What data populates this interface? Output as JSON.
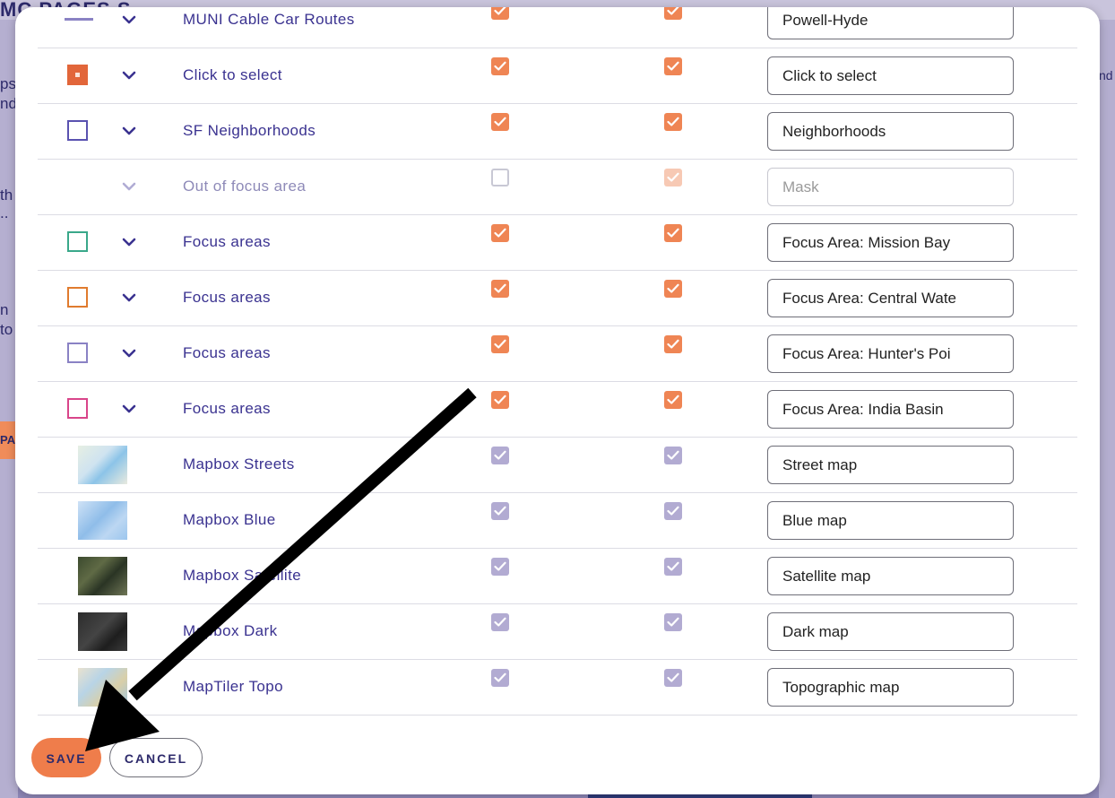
{
  "background": {
    "title_fragment": "MC PAGES S",
    "left_fragments": [
      "ps",
      "nd",
      "th",
      "..",
      "n",
      "to"
    ],
    "left_button_fragment": "PA",
    "right_fragment": "nd"
  },
  "layers": [
    {
      "swatch": "line",
      "chevron": true,
      "name": "MUNI Cable Car Routes",
      "c1": "on",
      "c2": "on",
      "label": "Powell-Hyde",
      "dim": false
    },
    {
      "swatch": "fill",
      "chevron": true,
      "name": "Click to select",
      "c1": "on",
      "c2": "on",
      "label": "Click to select",
      "dim": false
    },
    {
      "swatch": "outline",
      "color": "#5a52b0",
      "chevron": true,
      "name": "SF Neighborhoods",
      "c1": "on",
      "c2": "on",
      "label": "Neighborhoods",
      "dim": false
    },
    {
      "swatch": "none",
      "chevron": true,
      "name": "Out of focus area",
      "c1": "off",
      "c2": "faint",
      "label": "Mask",
      "dim": true
    },
    {
      "swatch": "outline",
      "color": "#3aa88a",
      "chevron": true,
      "name": "Focus areas",
      "c1": "on",
      "c2": "on",
      "label": "Focus Area: Mission Bay",
      "dim": false
    },
    {
      "swatch": "outline",
      "color": "#e07b2e",
      "chevron": true,
      "name": "Focus areas",
      "c1": "on",
      "c2": "on",
      "label": "Focus Area: Central Wate",
      "dim": false
    },
    {
      "swatch": "outline",
      "color": "#8a82c4",
      "chevron": true,
      "name": "Focus areas",
      "c1": "on",
      "c2": "on",
      "label": "Focus Area: Hunter's Poi",
      "dim": false
    },
    {
      "swatch": "outline",
      "color": "#d9458a",
      "chevron": true,
      "name": "Focus areas",
      "c1": "on",
      "c2": "on",
      "label": "Focus Area: India Basin",
      "dim": false
    },
    {
      "swatch": "thumb",
      "thumb": "streets",
      "chevron": false,
      "name": "Mapbox Streets",
      "c1": "grey",
      "c2": "grey",
      "label": "Street map",
      "dim": false
    },
    {
      "swatch": "thumb",
      "thumb": "blue",
      "chevron": false,
      "name": "Mapbox Blue",
      "c1": "grey",
      "c2": "grey",
      "label": "Blue map",
      "dim": false
    },
    {
      "swatch": "thumb",
      "thumb": "satellite",
      "chevron": false,
      "name": "Mapbox Satellite",
      "c1": "grey",
      "c2": "grey",
      "label": "Satellite map",
      "dim": false
    },
    {
      "swatch": "thumb",
      "thumb": "dark",
      "chevron": false,
      "name": "Mapbox Dark",
      "c1": "grey",
      "c2": "grey",
      "label": "Dark map",
      "dim": false
    },
    {
      "swatch": "thumb",
      "thumb": "topo",
      "chevron": false,
      "name": "MapTiler Topo",
      "c1": "grey",
      "c2": "grey",
      "label": "Topographic map",
      "dim": false
    }
  ],
  "buttons": {
    "save": "SAVE",
    "cancel": "CANCEL"
  },
  "colors": {
    "accent": "#ef7d4b",
    "text": "#3a3290",
    "checked": "#ef8554",
    "basemap_checked": "#b2abd2"
  }
}
